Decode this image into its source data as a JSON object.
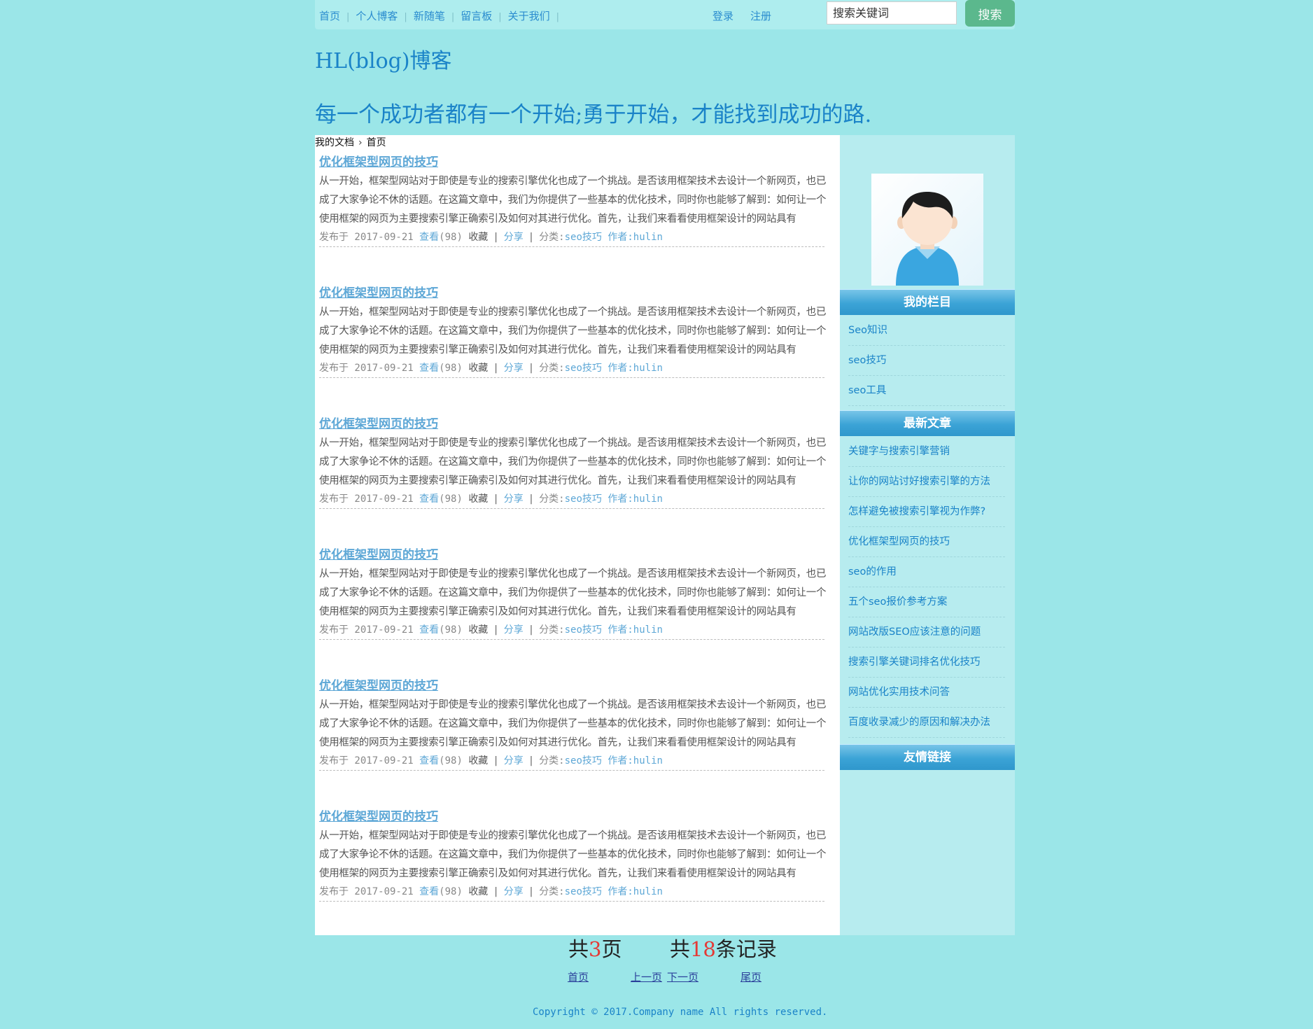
{
  "nav": {
    "items": [
      "首页",
      "个人博客",
      "新随笔",
      "留言板",
      "关于我们"
    ],
    "login": "登录",
    "register": "注册",
    "search_placeholder": "搜索关键词",
    "search_button": "搜索"
  },
  "site": {
    "title": "HL(blog)博客",
    "slogan": "每一个成功者都有一个开始;勇于开始，才能找到成功的路."
  },
  "breadcrumb": {
    "root": "我的文档",
    "current": "首页"
  },
  "posts": [
    {
      "title": "优化框架型网页的技巧",
      "body": "从一开始，框架型网站对于即使是专业的搜索引擎优化也成了一个挑战。是否该用框架技术去设计一个新网页，也已成了大家争论不休的话题。在这篇文章中，我们为你提供了一些基本的优化技术，同时你也能够了解到：如何让一个使用框架的网页为主要搜索引擎正确索引及如何对其进行优化。首先，让我们来看看使用框架设计的网站具有",
      "date": "发布于 2017-09-21",
      "views_label": "查看",
      "views": "(98)",
      "fav": "收藏",
      "share": "分享",
      "cat_label": "分类:",
      "cat": "seo技巧",
      "author": "作者:hulin"
    },
    {
      "title": "优化框架型网页的技巧",
      "body": "从一开始，框架型网站对于即使是专业的搜索引擎优化也成了一个挑战。是否该用框架技术去设计一个新网页，也已成了大家争论不休的话题。在这篇文章中，我们为你提供了一些基本的优化技术，同时你也能够了解到：如何让一个使用框架的网页为主要搜索引擎正确索引及如何对其进行优化。首先，让我们来看看使用框架设计的网站具有",
      "date": "发布于 2017-09-21",
      "views_label": "查看",
      "views": "(98)",
      "fav": "收藏",
      "share": "分享",
      "cat_label": "分类:",
      "cat": "seo技巧",
      "author": "作者:hulin"
    },
    {
      "title": "优化框架型网页的技巧",
      "body": "从一开始，框架型网站对于即使是专业的搜索引擎优化也成了一个挑战。是否该用框架技术去设计一个新网页，也已成了大家争论不休的话题。在这篇文章中，我们为你提供了一些基本的优化技术，同时你也能够了解到：如何让一个使用框架的网页为主要搜索引擎正确索引及如何对其进行优化。首先，让我们来看看使用框架设计的网站具有",
      "date": "发布于 2017-09-21",
      "views_label": "查看",
      "views": "(98)",
      "fav": "收藏",
      "share": "分享",
      "cat_label": "分类:",
      "cat": "seo技巧",
      "author": "作者:hulin"
    },
    {
      "title": "优化框架型网页的技巧",
      "body": "从一开始，框架型网站对于即使是专业的搜索引擎优化也成了一个挑战。是否该用框架技术去设计一个新网页，也已成了大家争论不休的话题。在这篇文章中，我们为你提供了一些基本的优化技术，同时你也能够了解到：如何让一个使用框架的网页为主要搜索引擎正确索引及如何对其进行优化。首先，让我们来看看使用框架设计的网站具有",
      "date": "发布于 2017-09-21",
      "views_label": "查看",
      "views": "(98)",
      "fav": "收藏",
      "share": "分享",
      "cat_label": "分类:",
      "cat": "seo技巧",
      "author": "作者:hulin"
    },
    {
      "title": "优化框架型网页的技巧",
      "body": "从一开始，框架型网站对于即使是专业的搜索引擎优化也成了一个挑战。是否该用框架技术去设计一个新网页，也已成了大家争论不休的话题。在这篇文章中，我们为你提供了一些基本的优化技术，同时你也能够了解到：如何让一个使用框架的网页为主要搜索引擎正确索引及如何对其进行优化。首先，让我们来看看使用框架设计的网站具有",
      "date": "发布于 2017-09-21",
      "views_label": "查看",
      "views": "(98)",
      "fav": "收藏",
      "share": "分享",
      "cat_label": "分类:",
      "cat": "seo技巧",
      "author": "作者:hulin"
    },
    {
      "title": "优化框架型网页的技巧",
      "body": "从一开始，框架型网站对于即使是专业的搜索引擎优化也成了一个挑战。是否该用框架技术去设计一个新网页，也已成了大家争论不休的话题。在这篇文章中，我们为你提供了一些基本的优化技术，同时你也能够了解到：如何让一个使用框架的网页为主要搜索引擎正确索引及如何对其进行优化。首先，让我们来看看使用框架设计的网站具有",
      "date": "发布于 2017-09-21",
      "views_label": "查看",
      "views": "(98)",
      "fav": "收藏",
      "share": "分享",
      "cat_label": "分类:",
      "cat": "seo技巧",
      "author": "作者:hulin"
    }
  ],
  "sidebar": {
    "columns_title": "我的栏目",
    "columns": [
      "Seo知识",
      "seo技巧",
      "seo工具"
    ],
    "latest_title": "最新文章",
    "latest": [
      "关键字与搜索引擎营销",
      "让你的网站讨好搜索引擎的方法",
      "怎样避免被搜索引擎视为作弊?",
      "优化框架型网页的技巧",
      "seo的作用",
      "五个seo报价参考方案",
      "网站改版SEO应该注意的问题",
      "搜索引擎关键词排名优化技巧",
      "网站优化实用技术问答",
      "百度收录减少的原因和解决办法"
    ],
    "links_title": "友情链接"
  },
  "pager": {
    "total_pages_prefix": "共",
    "total_pages": "3",
    "total_pages_suffix": "页",
    "total_records_prefix": "共",
    "total_records": "18",
    "total_records_suffix": "条记录",
    "first": "首页",
    "prev": "上一页",
    "next": "下一页",
    "last": "尾页"
  },
  "footer": {
    "copyright": "Copyright © 2017.Company name All rights reserved."
  },
  "colors": {
    "background": "#9be6e8",
    "link": "#1a83c8",
    "accent_button": "#5bb88d",
    "highlight": "#e53935"
  }
}
